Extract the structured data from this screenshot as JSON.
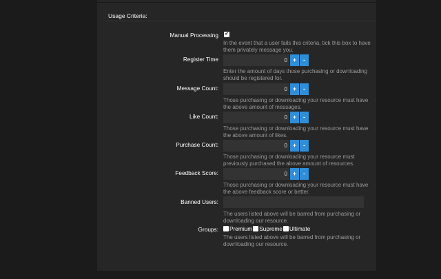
{
  "section_title": "Usage Criteria:",
  "manual_processing": {
    "label": "Manual Processing",
    "checked": true,
    "check_glyph": "✔",
    "hint": "In the event that a user fails this criteria, tick this box to have them privately message you."
  },
  "numeric_fields": [
    {
      "label": "Register Time",
      "value": "0",
      "hint": "Enter the amount of days those purchasing or downloading should be registered for."
    },
    {
      "label": "Message Count:",
      "value": "0",
      "hint": "Those purchasing or downloading your resource must have the above amount of messages."
    },
    {
      "label": "Like Count:",
      "value": "0",
      "hint": "Those purchasing or downloading your resource must have the above amount of likes."
    },
    {
      "label": "Purchase Count:",
      "value": "0",
      "hint": "Those purchasing or downloading your resource must previously purchased the above amount of resources."
    },
    {
      "label": "Feedback Score:",
      "value": "0",
      "hint": "Those purchasing or downloading your resource must have the above feedback score or better."
    }
  ],
  "stepper": {
    "plus": "+",
    "minus": "-"
  },
  "banned_users": {
    "label": "Banned Users:",
    "value": "",
    "hint": "The users listed above will be barred from purchasing or downloading our resource."
  },
  "groups": {
    "label": "Groups:",
    "options": [
      "Premium",
      "Supreme",
      "Ultimate"
    ],
    "hint": "The users listed above will be barred from purchasing or downloading our resource."
  },
  "colors": {
    "accent": "#2f8ed8",
    "background": "#1b1b1b",
    "panel": "#262626",
    "input": "#333333"
  }
}
